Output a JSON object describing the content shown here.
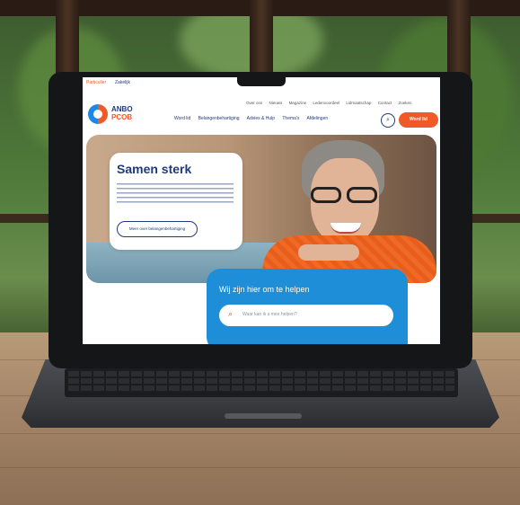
{
  "site": {
    "top_strip": [
      "Particulier",
      "Zakelijk"
    ],
    "top_links": [
      "Over ons",
      "Nieuws",
      "Magazine",
      "Ledenvoordeel",
      "Lidmaatschap",
      "Contact",
      "Zoeken"
    ],
    "logo_line1": "ANBO",
    "logo_line2": "PCOB",
    "nav": [
      "Word lid",
      "Belangenbehartiging",
      "Advies & Hulp",
      "Thema's",
      "Afdelingen"
    ],
    "cta": "Word lid",
    "search_icon_glyph": "⌕",
    "hero": {
      "title": "Samen sterk",
      "button": "Meer over belangenbehartiging"
    },
    "help": {
      "title": "Wij zijn hier om te helpen",
      "placeholder": "Waar kan ik u mee helpen?",
      "icon_glyph": "⌕"
    }
  },
  "colors": {
    "accent": "#f05a28",
    "brand": "#1e3a7b",
    "help_panel": "#1e8ed8"
  }
}
